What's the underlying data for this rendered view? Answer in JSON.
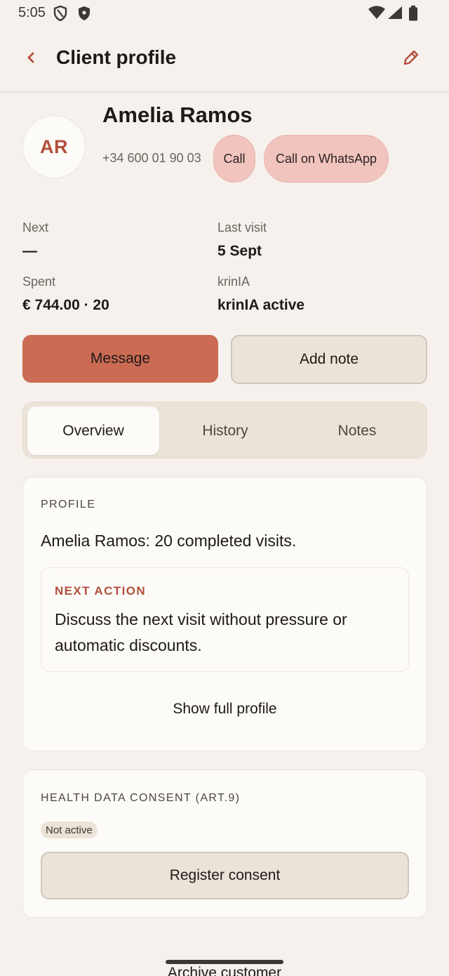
{
  "status_bar": {
    "time": "5:05",
    "icons": [
      "shield-outline-icon",
      "shield-filled-icon",
      "wifi-icon",
      "signal-icon",
      "battery-icon"
    ]
  },
  "app_bar": {
    "title": "Client profile",
    "back_icon": "chevron-left-icon",
    "edit_icon": "pencil-icon"
  },
  "client": {
    "initials": "AR",
    "name": "Amelia Ramos",
    "phone": "+34 600 01 90 03",
    "call_label": "Call",
    "whatsapp_label": "Call on WhatsApp"
  },
  "stats": {
    "next_label": "Next",
    "next_value": "—",
    "last_visit_label": "Last visit",
    "last_visit_value": "5 Sept",
    "spent_label": "Spent",
    "spent_value": "€ 744.00 · 20",
    "krinia_label": "krinIA",
    "krinia_value": "krinIA active"
  },
  "actions": {
    "message_label": "Message",
    "add_note_label": "Add note"
  },
  "tabs": [
    {
      "label": "Overview",
      "active": true
    },
    {
      "label": "History",
      "active": false
    },
    {
      "label": "Notes",
      "active": false
    }
  ],
  "profile_card": {
    "section_label": "PROFILE",
    "summary": "Amelia Ramos: 20 completed visits.",
    "next_action_label": "NEXT ACTION",
    "next_action_text": "Discuss the next visit without pressure or automatic discounts.",
    "show_full_label": "Show full profile"
  },
  "consent_card": {
    "section_label": "HEALTH DATA CONSENT (ART.9)",
    "status_badge": "Not active",
    "register_label": "Register consent"
  },
  "footer": {
    "archive_label": "Archive customer"
  },
  "colors": {
    "background": "#f6f1ec",
    "accent": "#cb6b54",
    "accent_text": "#b24f3c",
    "pill": "#f2c4be",
    "surface": "#fdfbf8",
    "muted_surface": "#ece3d8"
  }
}
